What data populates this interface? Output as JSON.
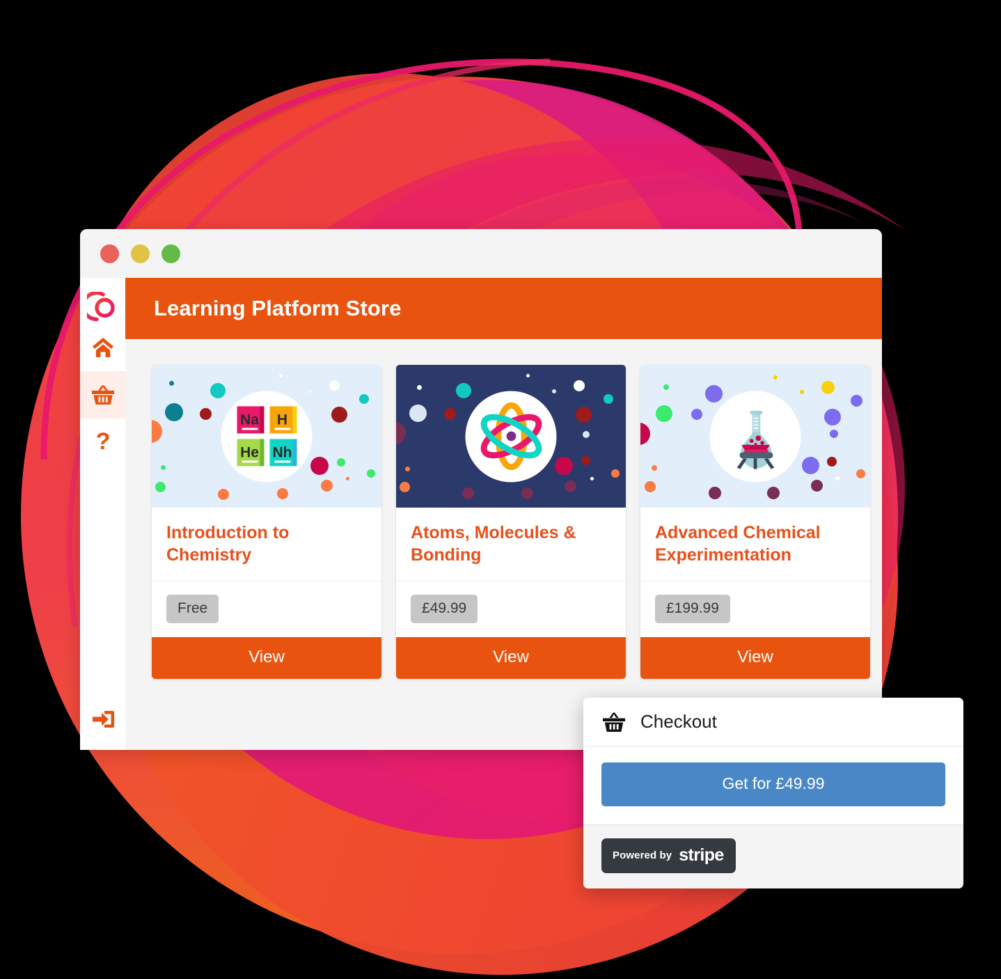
{
  "window": {
    "traffic_lights": [
      {
        "name": "close",
        "color": "#e8615a"
      },
      {
        "name": "minimize",
        "color": "#e0c245"
      },
      {
        "name": "maximize",
        "color": "#63bb46"
      }
    ]
  },
  "sidebar": {
    "logo_name": "brand-logo",
    "items": [
      {
        "icon": "home-icon",
        "label": "Home",
        "active": false
      },
      {
        "icon": "basket-icon",
        "label": "Store",
        "active": true
      },
      {
        "icon": "question-mark-icon",
        "label": "Help",
        "active": false
      }
    ],
    "bottom_item": {
      "icon": "logout-icon",
      "label": "Log out"
    }
  },
  "header": {
    "title": "Learning Platform Store"
  },
  "cards": [
    {
      "title": "Introduction to Chemistry",
      "price": "Free",
      "button": "View",
      "image": {
        "style": "light",
        "background": "#e3eefb",
        "icon": "periodic-elements-icon",
        "elements": [
          {
            "symbol": "Na",
            "color": "#e8196a"
          },
          {
            "symbol": "H",
            "color": "#f8a50c"
          },
          {
            "symbol": "He",
            "color": "#a5d84a"
          },
          {
            "symbol": "Nh",
            "color": "#10d5c4"
          }
        ]
      }
    },
    {
      "title": "Atoms, Molecules & Bonding",
      "price": "£49.99",
      "button": "View",
      "image": {
        "style": "dark",
        "background": "#2b3a6b",
        "icon": "atom-icon",
        "orbit_colors": [
          "#f8a50c",
          "#e8196a",
          "#10d5c4"
        ]
      }
    },
    {
      "title": "Advanced Chemical Experimentation",
      "price": "£199.99",
      "button": "View",
      "image": {
        "style": "light",
        "background": "#e3eefb",
        "icon": "flask-burner-icon",
        "flask_colors": [
          "#9ed0d9",
          "#c7075a",
          "#3c4a5a"
        ]
      }
    }
  ],
  "checkout": {
    "icon": "basket-icon",
    "title": "Checkout",
    "pay_button": "Get for £49.99",
    "powered_by": "Powered by",
    "provider": "stripe",
    "button_color": "#4a87c6"
  },
  "theme": {
    "accent_orange": "#e8540f",
    "title_orange": "#e8501b",
    "pill_grey": "#c6c6c6",
    "active_tint": "#fdeee9"
  }
}
